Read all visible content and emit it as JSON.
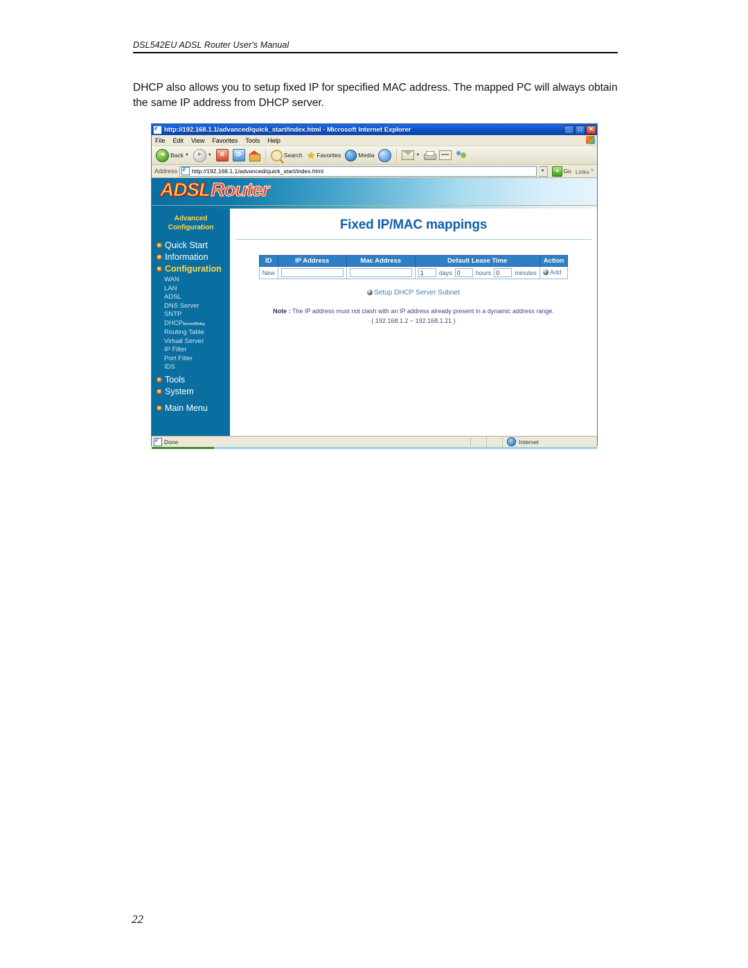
{
  "document": {
    "header": "DSL542EU ADSL Router User's Manual",
    "paragraph": "DHCP also allows you to setup fixed IP for specified MAC address. The mapped PC will always obtain the same IP address from DHCP server.",
    "page_number": "22"
  },
  "browser": {
    "title": "http://192.168.1.1/advanced/quick_start/index.html - Microsoft Internet Explorer",
    "window_buttons": {
      "minimize": "_",
      "maximize": "□",
      "close": "✕"
    },
    "menu": [
      "File",
      "Edit",
      "View",
      "Favorites",
      "Tools",
      "Help"
    ],
    "toolbar": {
      "back": "Back",
      "forward": "",
      "stop": "",
      "refresh": "",
      "home": "",
      "search": "Search",
      "favorites": "Favorites",
      "media": "Media",
      "history": "",
      "mail": "",
      "print": "",
      "edit": "",
      "messenger": ""
    },
    "address": {
      "label": "Address",
      "value": "http://192.168.1.1/advanced/quick_start/index.html",
      "go": "Go",
      "links": "Links"
    },
    "status": {
      "text": "Done",
      "zone": "Internet"
    }
  },
  "router_ui": {
    "logo": {
      "part1": "ADSL",
      "part2": "Router"
    },
    "sidebar": {
      "title_line1": "Advanced",
      "title_line2": "Configuration",
      "items": [
        {
          "label": "Quick Start",
          "active": false
        },
        {
          "label": "Information",
          "active": false
        },
        {
          "label": "Configuration",
          "active": true
        }
      ],
      "sub_items": [
        {
          "label": "WAN",
          "suffix": ""
        },
        {
          "label": "LAN",
          "suffix": ""
        },
        {
          "label": "ADSL",
          "suffix": ""
        },
        {
          "label": "DNS Server",
          "suffix": ""
        },
        {
          "label": "SNTP",
          "suffix": ""
        },
        {
          "label": "DHCP",
          "suffix": "Server/Relay"
        },
        {
          "label": "Routing Table",
          "suffix": ""
        },
        {
          "label": "Virtual Server",
          "suffix": ""
        },
        {
          "label": "IP Filter",
          "suffix": ""
        },
        {
          "label": "Port Filter",
          "suffix": ""
        },
        {
          "label": "IDS",
          "suffix": ""
        }
      ],
      "items_bottom": [
        {
          "label": "Tools"
        },
        {
          "label": "System"
        }
      ],
      "main_menu": "Main Menu"
    },
    "page_title": "Fixed IP/MAC mappings",
    "table": {
      "headers": [
        "ID",
        "IP Address",
        "Mac Address",
        "Default Lease Time",
        "Action"
      ],
      "row": {
        "id": "New",
        "ip_address": "",
        "mac_address": "",
        "days": "1",
        "days_label": "days",
        "hours": "0",
        "hours_label": "hours",
        "minutes": "0",
        "minutes_label": "minutes",
        "action": "Add"
      }
    },
    "subnet_link": "Setup DHCP Server Subnet",
    "note": {
      "prefix": "Note :",
      "text": "The IP address must not clash with an IP address already present in a dynamic address range.",
      "range": "( 192.168.1.2 ~ 192.168.1.21 )"
    },
    "colors": {
      "sidebar_bg": "#0a6ea0",
      "title_blue": "#0f5fa8",
      "accent_yellow": "#ffd84a",
      "table_header": "#2f7fc4",
      "link_blue": "#3a7ec0",
      "note_purple": "#4a3f7a"
    }
  }
}
